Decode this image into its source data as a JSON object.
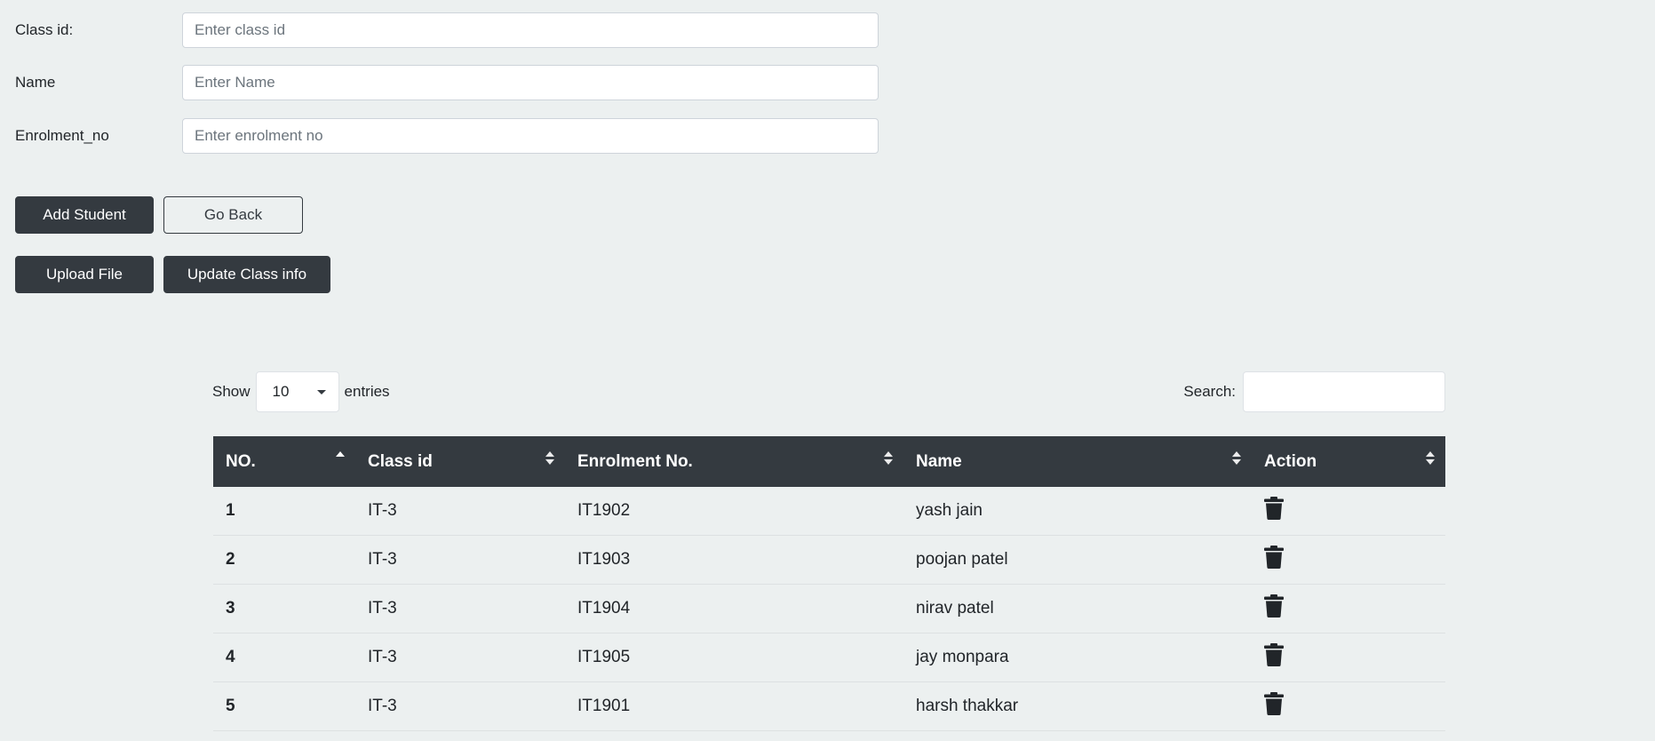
{
  "form": {
    "fields": [
      {
        "label": "Class id:",
        "placeholder": "Enter class id"
      },
      {
        "label": "Name",
        "placeholder": "Enter Name"
      },
      {
        "label": "Enrolment_no",
        "placeholder": "Enter enrolment no"
      }
    ]
  },
  "buttons": {
    "add_student": "Add Student",
    "go_back": "Go Back",
    "upload_file": "Upload File",
    "update_class_info": "Update Class info"
  },
  "table_controls": {
    "show_label": "Show",
    "entries_value": "10",
    "entries_label": "entries",
    "search_label": "Search:"
  },
  "table": {
    "columns": [
      "NO.",
      "Class id",
      "Enrolment No.",
      "Name",
      "Action"
    ],
    "rows": [
      {
        "no": "1",
        "class_id": "IT-3",
        "enrolment_no": "IT1902",
        "name": "yash jain"
      },
      {
        "no": "2",
        "class_id": "IT-3",
        "enrolment_no": "IT1903",
        "name": "poojan patel"
      },
      {
        "no": "3",
        "class_id": "IT-3",
        "enrolment_no": "IT1904",
        "name": "nirav patel"
      },
      {
        "no": "4",
        "class_id": "IT-3",
        "enrolment_no": "IT1905",
        "name": "jay monpara"
      },
      {
        "no": "5",
        "class_id": "IT-3",
        "enrolment_no": "IT1901",
        "name": "harsh thakkar"
      }
    ],
    "action_icon": "trash-icon",
    "sorted_column": "NO.",
    "sort_direction": "ascending"
  },
  "colors": {
    "background": "#ecf0f0",
    "dark": "#343a40",
    "white": "#ffffff"
  }
}
